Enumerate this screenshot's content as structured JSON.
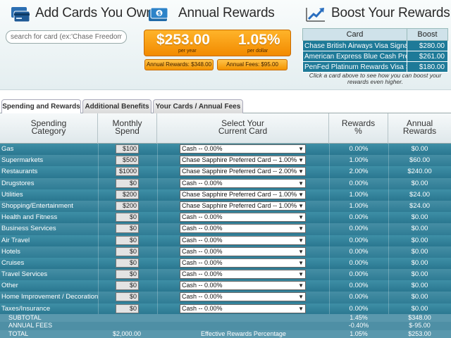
{
  "add_cards": {
    "title": "Add Cards You Own",
    "search_placeholder": "search for card (ex:'Chase Freedom')",
    "icon": "cards-icon"
  },
  "annual_rewards": {
    "title": "Annual Rewards",
    "icon": "money-icon",
    "amount": "$253.00",
    "amount_sub": "per year",
    "rate": "1.05%",
    "rate_sub": "per dollar",
    "rewards_box": "Annual Rewards: $348.00",
    "fees_box": "Annual Fees: $95.00"
  },
  "boost": {
    "title": "Boost Your Rewards",
    "icon": "trend-up-icon",
    "columns": [
      "Card",
      "Boost"
    ],
    "rows": [
      {
        "card": "Chase British Airways Visa Signature",
        "boost": "$280.00"
      },
      {
        "card": "American Express Blue Cash Preferred",
        "boost": "$261.00"
      },
      {
        "card": "PenFed Platinum Rewards Visa Signature",
        "boost": "$180.00"
      }
    ],
    "hint": "Click a card above to see how you can boost your rewards even higher."
  },
  "tabs": [
    {
      "label": "Spending and Rewards",
      "active": true
    },
    {
      "label": "Additional Benefits",
      "active": false
    },
    {
      "label": "Your Cards / Annual Fees",
      "active": false
    }
  ],
  "table_headers": {
    "category": [
      "Spending",
      "Category"
    ],
    "spend": [
      "Monthly",
      "Spend"
    ],
    "card": [
      "Select Your",
      "Current Card"
    ],
    "rewards": [
      "Rewards",
      "%"
    ],
    "annual": [
      "Annual",
      "Rewards"
    ]
  },
  "rows": [
    {
      "category": "Gas",
      "spend": "$100",
      "card": "Cash -- 0.00%",
      "pct": "0.00%",
      "annual": "$0.00"
    },
    {
      "category": "Supermarkets",
      "spend": "$500",
      "card": "Chase Sapphire Preferred Card -- 1.00%",
      "pct": "1.00%",
      "annual": "$60.00"
    },
    {
      "category": "Restaurants",
      "spend": "$1000",
      "card": "Chase Sapphire Preferred Card -- 2.00%",
      "pct": "2.00%",
      "annual": "$240.00"
    },
    {
      "category": "Drugstores",
      "spend": "$0",
      "card": "Cash -- 0.00%",
      "pct": "0.00%",
      "annual": "$0.00"
    },
    {
      "category": "Utilities",
      "spend": "$200",
      "card": "Chase Sapphire Preferred Card -- 1.00%",
      "pct": "1.00%",
      "annual": "$24.00"
    },
    {
      "category": "Shopping/Entertainment",
      "spend": "$200",
      "card": "Chase Sapphire Preferred Card -- 1.00%",
      "pct": "1.00%",
      "annual": "$24.00"
    },
    {
      "category": "Health and Fitness",
      "spend": "$0",
      "card": "Cash -- 0.00%",
      "pct": "0.00%",
      "annual": "$0.00"
    },
    {
      "category": "Business Services",
      "spend": "$0",
      "card": "Cash -- 0.00%",
      "pct": "0.00%",
      "annual": "$0.00"
    },
    {
      "category": "Air Travel",
      "spend": "$0",
      "card": "Cash -- 0.00%",
      "pct": "0.00%",
      "annual": "$0.00"
    },
    {
      "category": "Hotels",
      "spend": "$0",
      "card": "Cash -- 0.00%",
      "pct": "0.00%",
      "annual": "$0.00"
    },
    {
      "category": "Cruises",
      "spend": "$0",
      "card": "Cash -- 0.00%",
      "pct": "0.00%",
      "annual": "$0.00"
    },
    {
      "category": "Travel Services",
      "spend": "$0",
      "card": "Cash -- 0.00%",
      "pct": "0.00%",
      "annual": "$0.00"
    },
    {
      "category": "Other",
      "spend": "$0",
      "card": "Cash -- 0.00%",
      "pct": "0.00%",
      "annual": "$0.00"
    },
    {
      "category": "Home Improvement / Decoration",
      "spend": "$0",
      "card": "Cash -- 0.00%",
      "pct": "0.00%",
      "annual": "$0.00"
    },
    {
      "category": "Taxes/Insurance",
      "spend": "$0",
      "card": "Cash -- 0.00%",
      "pct": "0.00%",
      "annual": "$0.00"
    }
  ],
  "totals": {
    "subtotal": {
      "label": "SUBTOTAL",
      "pct": "1.45%",
      "annual": "$348.00"
    },
    "fees": {
      "label": "ANNUAL FEES",
      "pct": "-0.40%",
      "annual": "$-95.00"
    },
    "total": {
      "label": "TOTAL",
      "spend": "$2,000.00",
      "mid": "Effective Rewards Percentage",
      "pct": "1.05%",
      "annual": "$253.00"
    }
  },
  "colors": {
    "row_bg": "#2a7790",
    "accent_orange": "#f28a00",
    "boost_row": "#1e7a98"
  }
}
